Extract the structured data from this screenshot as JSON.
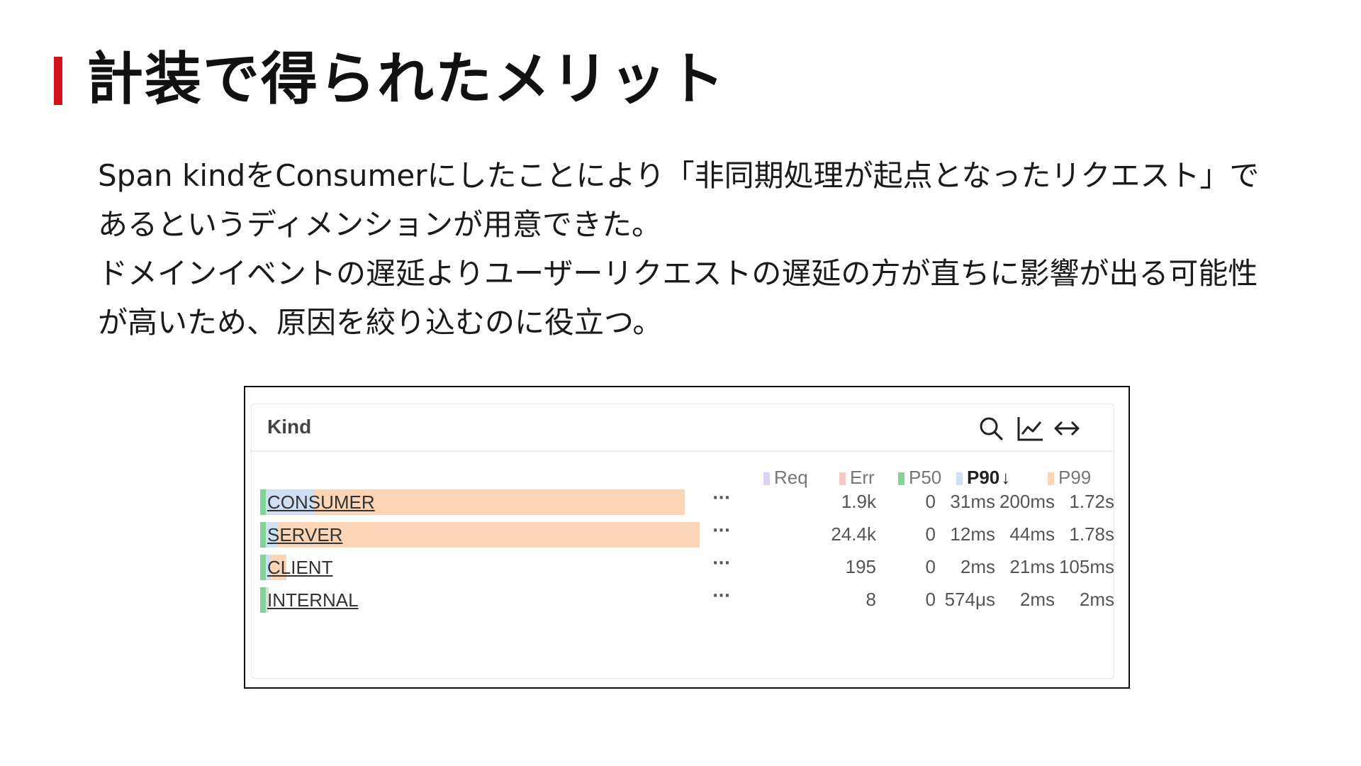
{
  "slide": {
    "title": "計装で得られたメリット",
    "accent_color": "#d0121b",
    "paragraphs": [
      "Span kindをConsumerにしたことにより「非同期処理が起点となったリクエスト」であるというディメンションが用意できた。",
      "ドメインイベントの遅延よりユーザーリクエストの遅延の方が直ちに影響が出る可能性が高いため、原因を絞り込むのに役立つ。"
    ]
  },
  "panel": {
    "title": "Kind",
    "icons": [
      "search-icon",
      "line-chart-icon",
      "expand-horizontal-icon"
    ],
    "columns": [
      {
        "key": "req",
        "label": "Req",
        "color": "#dcd0f4"
      },
      {
        "key": "err",
        "label": "Err",
        "color": "#f8c9c9"
      },
      {
        "key": "p50",
        "label": "P50",
        "color": "#84d49a"
      },
      {
        "key": "p90",
        "label": "P90",
        "sort": "↓",
        "color": "#cde0f6"
      },
      {
        "key": "p99",
        "label": "P99",
        "color": "#fbd5b5"
      }
    ],
    "more_label": "···",
    "rows": [
      {
        "label": "CONSUMER",
        "req": "1.9k",
        "err": "0",
        "p50": "31ms",
        "p90": "200ms",
        "p99": "1.72s",
        "p90_fraction": 0.112,
        "p99_fraction": 0.966
      },
      {
        "label": "SERVER",
        "req": "24.4k",
        "err": "0",
        "p50": "12ms",
        "p90": "44ms",
        "p99": "1.78s",
        "p90_fraction": 0.025,
        "p99_fraction": 1.0
      },
      {
        "label": "CLIENT",
        "req": "195",
        "err": "0",
        "p50": "2ms",
        "p90": "21ms",
        "p99": "105ms",
        "p90_fraction": 0.012,
        "p99_fraction": 0.059
      },
      {
        "label": "INTERNAL",
        "req": "8",
        "err": "0",
        "p50": "574μs",
        "p90": "2ms",
        "p99": "2ms",
        "p90_fraction": 0.001,
        "p99_fraction": 0.001
      }
    ]
  }
}
